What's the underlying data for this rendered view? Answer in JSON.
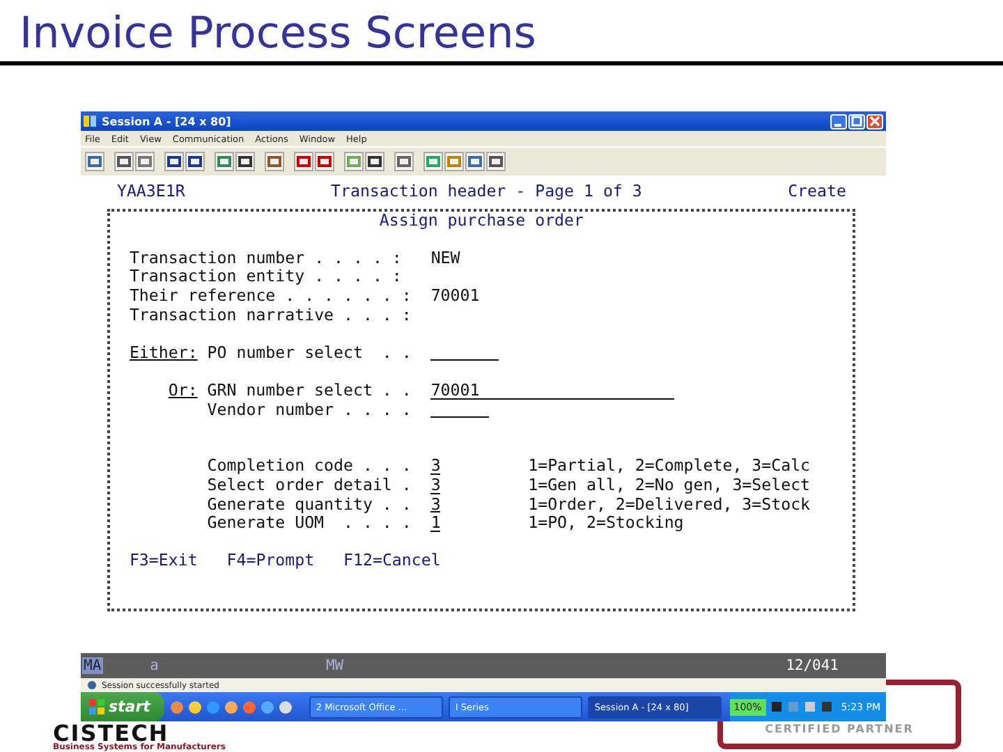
{
  "slide_title": "Invoice Process Screens",
  "window": {
    "title": "Session A - [24 x 80]",
    "menu": [
      "File",
      "Edit",
      "View",
      "Communication",
      "Actions",
      "Window",
      "Help"
    ]
  },
  "terminal": {
    "program_id": "YAA3E1R",
    "screen_title": "Transaction header - Page 1 of 3",
    "mode": "Create",
    "panel_title": "Assign purchase order",
    "field_groups": [
      {
        "kind": "header",
        "fields": [
          {
            "label": "Transaction number . . . . :",
            "kind": "display",
            "value": "NEW"
          },
          {
            "label": "Transaction entity . . . . :",
            "kind": "display"
          },
          {
            "label": "Their reference . . . . . . :",
            "kind": "display",
            "value": "70001"
          },
          {
            "label": "Transaction narrative . . . :",
            "kind": "display"
          }
        ]
      },
      {
        "kind": "selection",
        "fields": [
          {
            "prompt": "Either:",
            "label": "PO number select  . .",
            "kind": "input"
          }
        ]
      },
      {
        "kind": "selection",
        "fields": [
          {
            "prompt": "Or:",
            "label": "GRN number select . .",
            "kind": "input",
            "value": "70001"
          },
          {
            "label": "Vendor number . . . .",
            "kind": "input"
          }
        ]
      },
      {
        "kind": "selection",
        "fields": [
          {
            "label": "Completion code . . .",
            "kind": "input",
            "value": "3",
            "options": "1=Partial, 2=Complete, 3=Calc"
          },
          {
            "label": "Select order detail .",
            "kind": "input",
            "value": "3",
            "options": "1=Gen all, 2=No gen, 3=Select"
          },
          {
            "label": "Generate quantity . .",
            "kind": "input",
            "value": "3",
            "options": "1=Order, 2=Delivered, 3=Stock"
          },
          {
            "label": "Generate UOM  . . . .",
            "kind": "input",
            "value": "1",
            "options": "1=PO, 2=Stocking"
          }
        ]
      }
    ],
    "function_keys": [
      "F3=Exit",
      "F4=Prompt",
      "F12=Cancel"
    ]
  },
  "status_line": {
    "mode": "MA",
    "indicator": "a",
    "keyboard": "MW",
    "cursor_position": "12/041"
  },
  "message": "Session successfully started",
  "taskbar": {
    "start": "start",
    "tasks": [
      {
        "label": "2 Microsoft Office ...",
        "selected": false
      },
      {
        "label": "I Series",
        "selected": false
      },
      {
        "label": "Session A - [24 x 80]",
        "selected": true
      }
    ],
    "tray_badge": "100%",
    "clock": "5:23 PM"
  },
  "logos": {
    "left": {
      "name": "CISTECH",
      "tagline": "Business Systems for Manufacturers"
    },
    "right": {
      "text": "CERTIFIED PARTNER"
    }
  }
}
